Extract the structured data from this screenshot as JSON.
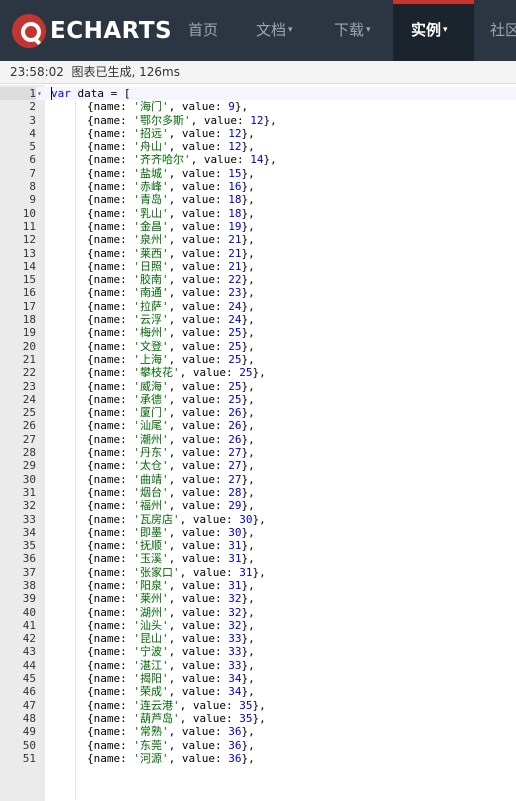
{
  "nav": {
    "logo_text": "ECHARTS",
    "items": [
      {
        "label": "首页",
        "caret": ""
      },
      {
        "label": "文档",
        "caret": "▾"
      },
      {
        "label": "下载",
        "caret": "▾"
      },
      {
        "label": "实例",
        "caret": "▾"
      },
      {
        "label": "社区",
        "caret": ""
      }
    ],
    "active_index": 3
  },
  "status": {
    "text": "23:58:02  图表已生成, 126ms"
  },
  "editor": {
    "first_line": {
      "number": "1",
      "fold": "▾",
      "keyword": "var",
      "rest": " data = ["
    },
    "entries": [
      {
        "name": "海门",
        "value": "9"
      },
      {
        "name": "鄂尔多斯",
        "value": "12"
      },
      {
        "name": "招远",
        "value": "12"
      },
      {
        "name": "舟山",
        "value": "12"
      },
      {
        "name": "齐齐哈尔",
        "value": "14"
      },
      {
        "name": "盐城",
        "value": "15"
      },
      {
        "name": "赤峰",
        "value": "16"
      },
      {
        "name": "青岛",
        "value": "18"
      },
      {
        "name": "乳山",
        "value": "18"
      },
      {
        "name": "金昌",
        "value": "19"
      },
      {
        "name": "泉州",
        "value": "21"
      },
      {
        "name": "莱西",
        "value": "21"
      },
      {
        "name": "日照",
        "value": "21"
      },
      {
        "name": "胶南",
        "value": "22"
      },
      {
        "name": "南通",
        "value": "23"
      },
      {
        "name": "拉萨",
        "value": "24"
      },
      {
        "name": "云浮",
        "value": "24"
      },
      {
        "name": "梅州",
        "value": "25"
      },
      {
        "name": "文登",
        "value": "25"
      },
      {
        "name": "上海",
        "value": "25"
      },
      {
        "name": "攀枝花",
        "value": "25"
      },
      {
        "name": "威海",
        "value": "25"
      },
      {
        "name": "承德",
        "value": "25"
      },
      {
        "name": "厦门",
        "value": "26"
      },
      {
        "name": "汕尾",
        "value": "26"
      },
      {
        "name": "潮州",
        "value": "26"
      },
      {
        "name": "丹东",
        "value": "27"
      },
      {
        "name": "太仓",
        "value": "27"
      },
      {
        "name": "曲靖",
        "value": "27"
      },
      {
        "name": "烟台",
        "value": "28"
      },
      {
        "name": "福州",
        "value": "29"
      },
      {
        "name": "瓦房店",
        "value": "30"
      },
      {
        "name": "即墨",
        "value": "30"
      },
      {
        "name": "抚顺",
        "value": "31"
      },
      {
        "name": "玉溪",
        "value": "31"
      },
      {
        "name": "张家口",
        "value": "31"
      },
      {
        "name": "阳泉",
        "value": "31"
      },
      {
        "name": "莱州",
        "value": "32"
      },
      {
        "name": "湖州",
        "value": "32"
      },
      {
        "name": "汕头",
        "value": "32"
      },
      {
        "name": "昆山",
        "value": "33"
      },
      {
        "name": "宁波",
        "value": "33"
      },
      {
        "name": "湛江",
        "value": "33"
      },
      {
        "name": "揭阳",
        "value": "34"
      },
      {
        "name": "荣成",
        "value": "34"
      },
      {
        "name": "连云港",
        "value": "35"
      },
      {
        "name": "葫芦岛",
        "value": "35"
      },
      {
        "name": "常熟",
        "value": "36"
      },
      {
        "name": "东莞",
        "value": "36"
      },
      {
        "name": "河源",
        "value": "36"
      }
    ]
  },
  "colors": {
    "navbar_bg": "#2c3643",
    "nav_active_bg": "#1b232c",
    "brand_red": "#c23531",
    "keyword": "#0000ff",
    "string": "#036a07",
    "number": "#0000cd"
  }
}
